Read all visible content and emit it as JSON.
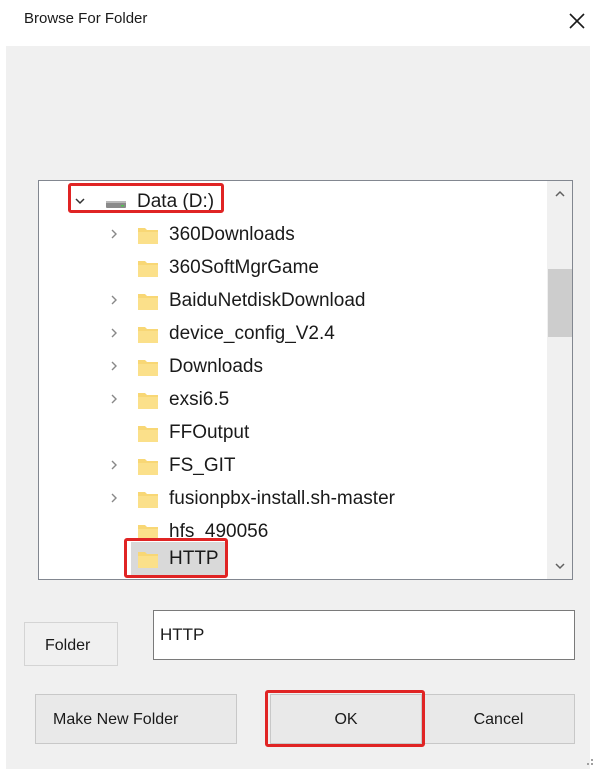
{
  "dialog": {
    "title": "Browse For Folder"
  },
  "tree": {
    "drive": {
      "label": "Data (D:)",
      "expanded": true
    },
    "items": [
      {
        "label": "360Downloads",
        "has_children": true
      },
      {
        "label": "360SoftMgrGame",
        "has_children": false
      },
      {
        "label": "BaiduNetdiskDownload",
        "has_children": true
      },
      {
        "label": "device_config_V2.4",
        "has_children": true
      },
      {
        "label": "Downloads",
        "has_children": true
      },
      {
        "label": "exsi6.5",
        "has_children": true
      },
      {
        "label": "FFOutput",
        "has_children": false
      },
      {
        "label": "FS_GIT",
        "has_children": true
      },
      {
        "label": "fusionpbx-install.sh-master",
        "has_children": true
      },
      {
        "label": "hfs_490056",
        "has_children": false
      },
      {
        "label": "HTTP",
        "has_children": false,
        "selected": true
      }
    ]
  },
  "folder_field": {
    "label_text": "Folder",
    "value": "HTTP"
  },
  "buttons": {
    "make_new_folder": "Make New Folder",
    "ok": "OK",
    "cancel": "Cancel"
  },
  "colors": {
    "highlight": "#e02424",
    "folder_yellow": "#f8d775",
    "selection": "#d9d9d9"
  }
}
